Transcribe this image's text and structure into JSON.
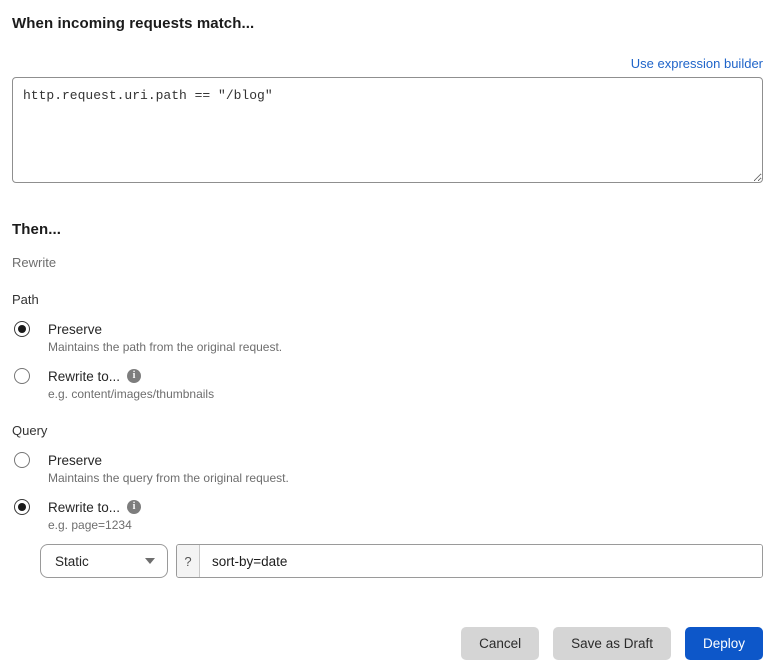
{
  "match_section": {
    "title": "When incoming requests match...",
    "builder_link": "Use expression builder",
    "expression": "http.request.uri.path == \"/blog\""
  },
  "then_section": {
    "title": "Then...",
    "subtitle": "Rewrite"
  },
  "path_group": {
    "label": "Path",
    "options": [
      {
        "label": "Preserve",
        "description": "Maintains the path from the original request.",
        "selected": true
      },
      {
        "label": "Rewrite to...",
        "description": "e.g. content/images/thumbnails",
        "selected": false,
        "info_icon": "i"
      }
    ]
  },
  "query_group": {
    "label": "Query",
    "options": [
      {
        "label": "Preserve",
        "description": "Maintains the query from the original request.",
        "selected": false
      },
      {
        "label": "Rewrite to...",
        "description": "e.g. page=1234",
        "selected": true,
        "info_icon": "i"
      }
    ],
    "rewrite_row": {
      "type_selected": "Static",
      "prefix": "?",
      "value": "sort-by=date"
    }
  },
  "footer": {
    "cancel_label": "Cancel",
    "save_draft_label": "Save as Draft",
    "deploy_label": "Deploy"
  },
  "colors": {
    "accent_blue": "#0d57c9",
    "link_blue": "#1f64c9",
    "button_gray": "#d5d5d5",
    "info_gray": "#7d7d7d"
  }
}
